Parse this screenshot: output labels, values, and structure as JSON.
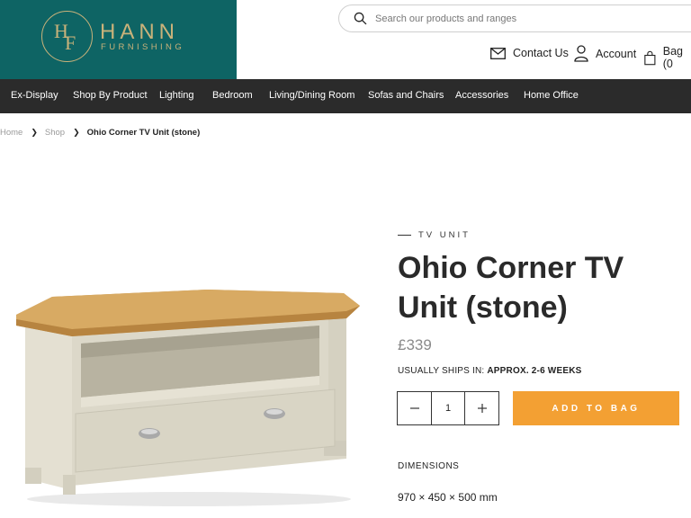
{
  "brand": {
    "monogram_top": "H",
    "monogram_bottom": "F",
    "name": "HANN",
    "subtitle": "FURNISHING",
    "color": "#0e6464",
    "accent": "#c9b27a"
  },
  "search": {
    "placeholder": "Search our products and ranges",
    "icon": "search-icon"
  },
  "header_links": {
    "contact": "Contact Us",
    "account": "Account",
    "bag": "Bag (0"
  },
  "nav": {
    "items": [
      "Ex-Display",
      "Shop By Product",
      "Lighting",
      "Bedroom",
      "Living/Dining Room",
      "Sofas and Chairs",
      "Accessories",
      "Home Office"
    ]
  },
  "breadcrumb": {
    "items": [
      "Home",
      "Shop",
      "Ohio Corner TV Unit (stone)"
    ]
  },
  "product": {
    "category": "TV UNIT",
    "title": "Ohio Corner TV Unit (stone)",
    "price": "£339",
    "ships_label": "USUALLY SHIPS IN:",
    "ships_value": "APPROX. 2-6 WEEKS",
    "quantity": "1",
    "add_to_bag": "ADD TO BAG",
    "dimensions_label": "DIMENSIONS",
    "dimensions_value": "970 × 450 × 500 mm",
    "button_color": "#f3a033"
  }
}
